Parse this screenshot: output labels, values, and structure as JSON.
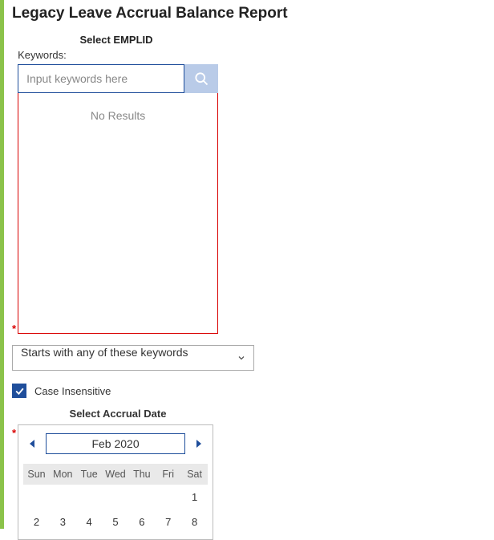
{
  "title": "Legacy Leave Accrual Balance Report",
  "emplid": {
    "section_label": "Select EMPLID",
    "field_label": "Keywords:",
    "placeholder": "Input keywords here",
    "no_results": "No Results",
    "match_mode": "Starts with any of these keywords",
    "case_insensitive_label": "Case Insensitive",
    "case_insensitive_checked": true
  },
  "accrual": {
    "section_label": "Select Accrual Date",
    "month_label": "Feb 2020",
    "weekdays": [
      "Sun",
      "Mon",
      "Tue",
      "Wed",
      "Thu",
      "Fri",
      "Sat"
    ],
    "rows": [
      [
        "",
        "",
        "",
        "",
        "",
        "",
        "1"
      ],
      [
        "2",
        "3",
        "4",
        "5",
        "6",
        "7",
        "8"
      ]
    ]
  }
}
